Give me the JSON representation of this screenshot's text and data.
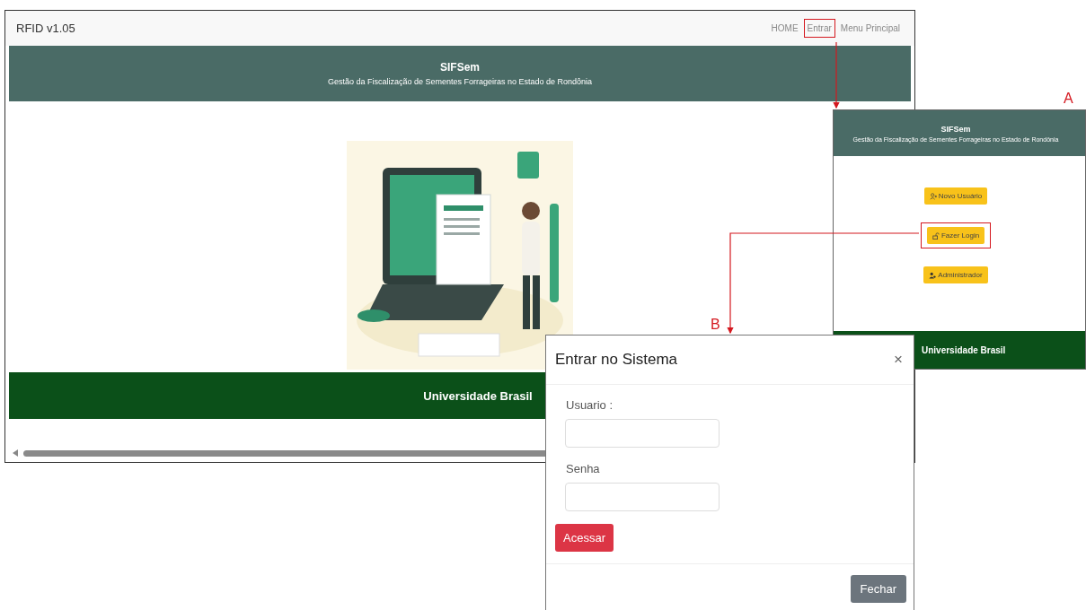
{
  "main_window": {
    "brand": "RFID v1.05",
    "nav": [
      {
        "label": "HOME",
        "highlighted": false
      },
      {
        "label": "Entrar",
        "highlighted": true
      },
      {
        "label": "Menu Principal",
        "highlighted": false
      }
    ],
    "header": {
      "title": "SIFSem",
      "subtitle": "Gestão da Fiscalização de Sementes Forrageiras no Estado de Rondônia"
    },
    "footer": "Universidade Brasil"
  },
  "panel_a": {
    "label": "A",
    "header": {
      "title": "SIFSem",
      "subtitle": "Gestão da Fiscalização de Sementes Forrageiras no Estado de Rondônia"
    },
    "buttons": [
      {
        "label": "Novo Usuário",
        "kind": "new-user",
        "highlighted": false
      },
      {
        "label": "Fazer Login",
        "kind": "login",
        "highlighted": true
      },
      {
        "label": "Administrador",
        "kind": "admin",
        "highlighted": false
      }
    ],
    "footer": "Universidade Brasil"
  },
  "panel_b": {
    "label": "B",
    "title": "Entrar no Sistema",
    "close": "×",
    "fields": [
      {
        "label": "Usuario :"
      },
      {
        "label": "Senha"
      }
    ],
    "submit": "Acessar",
    "dismiss": "Fechar"
  }
}
